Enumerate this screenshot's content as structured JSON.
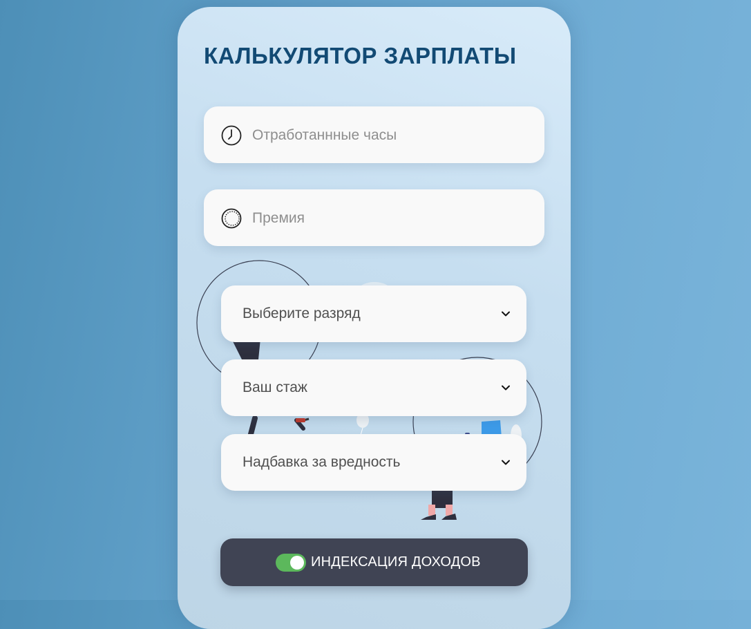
{
  "app": {
    "title": "КАЛЬКУЛЯТОР ЗАРПЛАТЫ"
  },
  "fields": {
    "hours": {
      "placeholder": "Отработаннные часы",
      "value": "",
      "icon": "clock-icon"
    },
    "bonus": {
      "placeholder": "Премия",
      "value": "",
      "icon": "coin-icon"
    }
  },
  "selects": {
    "grade": {
      "label": "Выберите разряд",
      "icon": "chevron-down-icon"
    },
    "experience": {
      "label": "Ваш стаж",
      "icon": "chevron-down-icon"
    },
    "hazard": {
      "label": "Надбавка за вредность",
      "icon": "chevron-down-icon"
    }
  },
  "toggle": {
    "label": "ИНДЕКСАЦИЯ ДОХОДОВ",
    "state": "on",
    "color": "#5cb85c"
  },
  "colors": {
    "title": "#124a74",
    "button_bg": "#404454",
    "field_bg": "#f9f9f9"
  }
}
